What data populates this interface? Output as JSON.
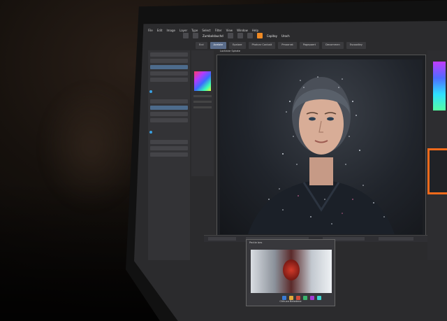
{
  "menu": {
    "items": [
      "File",
      "Edit",
      "Image",
      "Layer",
      "Type",
      "Select",
      "Filter",
      "View",
      "Window",
      "Help"
    ]
  },
  "toolbar": {
    "doc_label": "Zumbolsbuchd",
    "right_label": "Copitay",
    "right_label2": "Uroch"
  },
  "tabs": [
    {
      "label": "Ecd",
      "active": false
    },
    {
      "label": "Acelote",
      "active": true
    },
    {
      "label": "Epalore",
      "active": false
    },
    {
      "label": "Photcar Conbait",
      "active": false
    },
    {
      "label": "Pmoorrat",
      "active": false
    },
    {
      "label": "Pagepaert",
      "active": false
    },
    {
      "label": "Decommen",
      "active": false
    },
    {
      "label": "Escoodley",
      "active": false
    }
  ],
  "canvas": {
    "title": "Loctiane Sphate"
  },
  "preview": {
    "title": "Pectie bes",
    "caption": "Chhuca Belzdnne"
  },
  "colors": {
    "accent_orange": "#f26a1b",
    "accent_blue": "#3aa0e0",
    "panel_bg": "#2b2b2d"
  }
}
